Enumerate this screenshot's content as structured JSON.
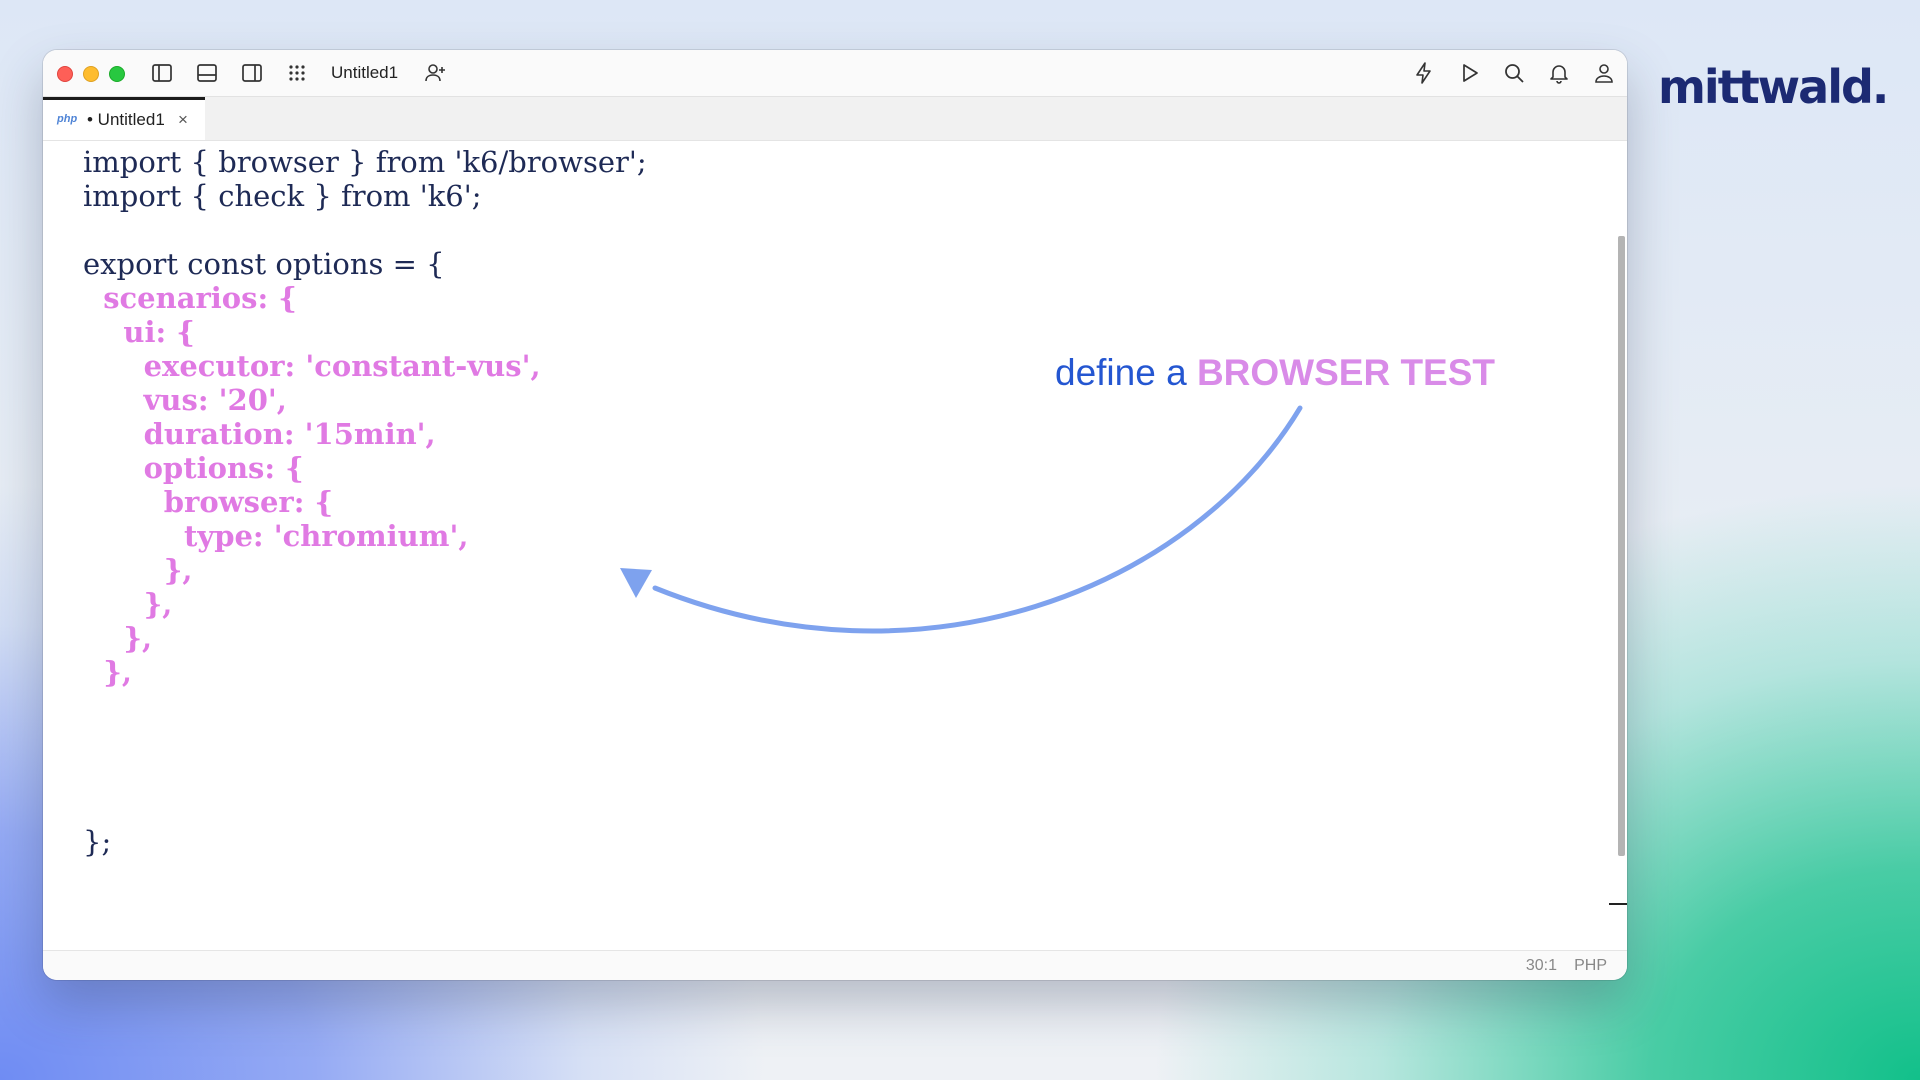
{
  "brand": {
    "name": "mittwald."
  },
  "window": {
    "title": "Untitled1",
    "toolbar_icons_left": [
      "sidebar-left-icon",
      "panel-bottom-icon",
      "sidebar-right-icon",
      "grid-icon",
      "add-user-icon"
    ],
    "toolbar_icons_right": [
      "bolt-icon",
      "play-icon",
      "search-icon",
      "bell-icon",
      "user-icon"
    ]
  },
  "tab": {
    "lang_badge": "php",
    "label": "• Untitled1",
    "close": "×"
  },
  "code": {
    "lines": [
      "import { browser } from 'k6/browser';",
      "import { check } from 'k6';",
      "",
      "export const options = {",
      "  scenarios: {",
      "    ui: {",
      "      executor: 'constant-vus',",
      "      vus: '20',",
      "      duration: '15min',",
      "      options: {",
      "        browser: {",
      "          type: 'chromium',",
      "        },",
      "      },",
      "    },",
      "  },",
      "",
      "",
      "",
      "",
      "};"
    ],
    "highlighted_lines": [
      4,
      5,
      6,
      7,
      8,
      9,
      10,
      11,
      12,
      13,
      14,
      15
    ]
  },
  "status": {
    "position": "30:1",
    "language": "PHP"
  },
  "annotation": {
    "prefix": "define a ",
    "emphasis": "BROWSER TEST"
  },
  "colors": {
    "code_text": "#1e2a55",
    "code_highlight": "#e07ae3",
    "annotation_text": "#2456d1",
    "annotation_emphasis": "#d98be8",
    "arrow": "#7ea2ee",
    "brand": "#1c2a73"
  }
}
